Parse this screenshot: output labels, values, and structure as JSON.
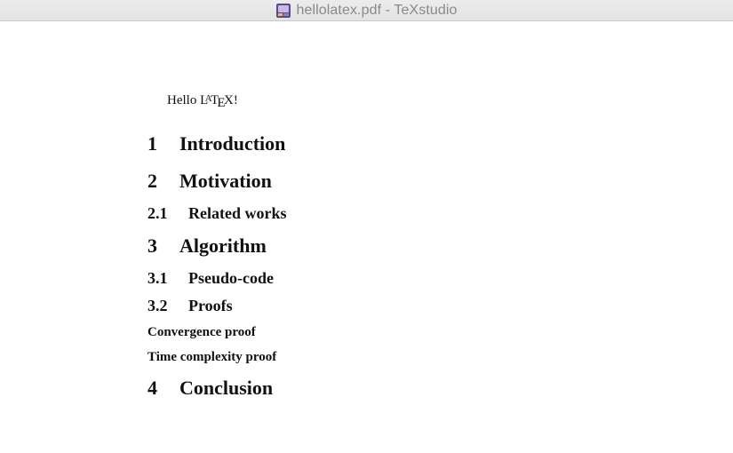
{
  "window": {
    "title": "hellolatex.pdf - TeXstudio",
    "app_icon": "texstudio-app-icon"
  },
  "document": {
    "greeting": {
      "prefix": "Hello ",
      "logo_text": "LaTeX",
      "logo_parts": [
        "L",
        "A",
        "T",
        "E",
        "X"
      ],
      "suffix": "!"
    },
    "sections": [
      {
        "level": "section",
        "number": "1",
        "title": "Introduction"
      },
      {
        "level": "section",
        "number": "2",
        "title": "Motivation"
      },
      {
        "level": "subsection",
        "number": "2.1",
        "title": "Related works"
      },
      {
        "level": "section",
        "number": "3",
        "title": "Algorithm"
      },
      {
        "level": "subsection",
        "number": "3.1",
        "title": "Pseudo-code"
      },
      {
        "level": "subsection",
        "number": "3.2",
        "title": "Proofs"
      },
      {
        "level": "subsubsection",
        "number": "",
        "title": "Convergence proof"
      },
      {
        "level": "subsubsection",
        "number": "",
        "title": "Time complexity proof"
      },
      {
        "level": "section",
        "number": "4",
        "title": "Conclusion"
      }
    ]
  }
}
